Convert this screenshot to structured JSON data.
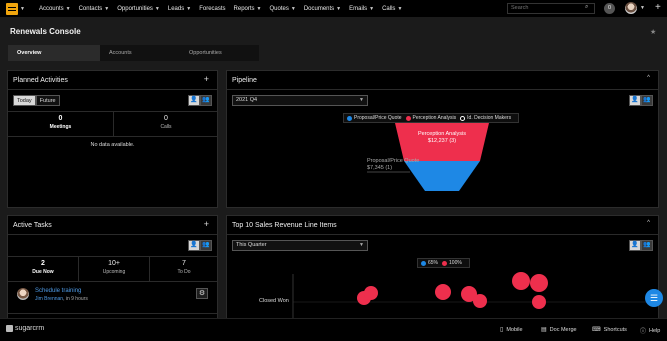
{
  "nav": {
    "items": [
      {
        "label": "Accounts",
        "caret": true
      },
      {
        "label": "Contacts",
        "caret": true
      },
      {
        "label": "Opportunities",
        "caret": true
      },
      {
        "label": "Leads",
        "caret": true
      },
      {
        "label": "Forecasts",
        "caret": false
      },
      {
        "label": "Reports",
        "caret": true
      },
      {
        "label": "Quotes",
        "caret": true
      },
      {
        "label": "Documents",
        "caret": true
      },
      {
        "label": "Emails",
        "caret": true
      },
      {
        "label": "Calls",
        "caret": true
      }
    ],
    "search_placeholder": "Search",
    "notification_count": "0"
  },
  "console": {
    "title": "Renewals Console",
    "tabs": [
      "Overview",
      "Accounts",
      "Opportunities"
    ]
  },
  "planned_activities": {
    "title": "Planned Activities",
    "toggle": [
      "Today",
      "Future"
    ],
    "stats": [
      {
        "value": "0",
        "label": "Meetings"
      },
      {
        "value": "0",
        "label": "Calls"
      }
    ],
    "empty_text": "No data available."
  },
  "pipeline": {
    "title": "Pipeline",
    "period": "2021 Q4",
    "legend": [
      "Proposal/Price Quote",
      "Perception Analysis",
      "Id. Decision Makers"
    ],
    "top_stage": {
      "name": "Perception Analysis",
      "amount": "$12,237 (3)"
    },
    "bottom_stage": {
      "name": "Proposal/Price Quote",
      "amount": "$7,345 (1)"
    },
    "colors": {
      "proposal": "#1e88e5",
      "perception": "#ee2f4d",
      "decision": "#ffffff"
    }
  },
  "active_tasks": {
    "title": "Active Tasks",
    "stats": [
      {
        "value": "2",
        "label": "Due Now"
      },
      {
        "value": "10+",
        "label": "Upcoming"
      },
      {
        "value": "7",
        "label": "To Do"
      }
    ],
    "task": {
      "title": "Schedule training",
      "assignee": "Jim Brennan",
      "due": ", in 9 hours"
    }
  },
  "top10": {
    "title": "Top 10 Sales Revenue Line Items",
    "period": "This Quarter",
    "legend": [
      "65%",
      "100%"
    ],
    "y_label": "Closed Won"
  },
  "footer": {
    "brand": "sugarcrm",
    "items": [
      "Mobile",
      "Doc Merge",
      "Shortcuts",
      "Help"
    ]
  }
}
